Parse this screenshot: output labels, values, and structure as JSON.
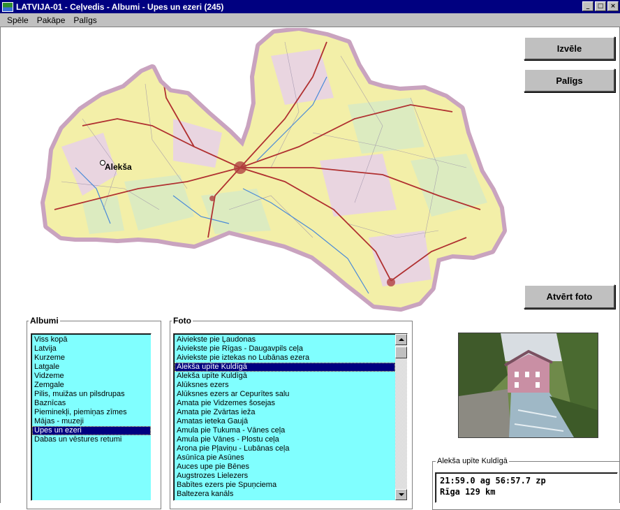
{
  "window": {
    "title": "LATVIJA-01 - Ceļvedis - Albumi - Upes un ezeri (245)",
    "controls": {
      "minimize": "_",
      "maximize": "□",
      "close": "×"
    }
  },
  "menu": [
    "Spēle",
    "Pakāpe",
    "Palīgs"
  ],
  "buttons": {
    "izvele": "Izvēle",
    "paligs": "Palīgs",
    "atvert_foto": "Atvērt foto"
  },
  "map": {
    "marker_label": "Alekša"
  },
  "albumi": {
    "label": "Albumi",
    "items": [
      "Viss kopā",
      "Latvija",
      "Kurzeme",
      "Latgale",
      "Vidzeme",
      "Zemgale",
      "Pilis, muižas un pilsdrupas",
      "Baznīcas",
      "Pieminekļi, piemiņas zīmes",
      "Mājas - muzeji",
      "Upes un ezeri",
      "Dabas un vēstures retumi"
    ],
    "selected_index": 10
  },
  "foto": {
    "label": "Foto",
    "items": [
      "Aiviekste pie Ļaudonas",
      "Aiviekste pie Rīgas - Daugavpils ceļa",
      "Aiviekste pie iztekas no Lubānas ezera",
      "Alekša upīte Kuldīgā",
      "Alekša upīte Kuldīgā",
      "Alūksnes ezers",
      "Alūksnes ezers ar Cepurītes salu",
      "Amata pie Vidzemes šosejas",
      "Amata pie Zvārtas ieža",
      "Amatas ieteka Gaujā",
      "Amula pie Tukuma - Vānes ceļa",
      "Amula pie Vānes - Plostu ceļa",
      "Arona pie Pļaviņu - Lubānas ceļa",
      "Asūnīca pie Asūnes",
      "Auces upe pie Bēnes",
      "Augstrozes Lielezers",
      "Babītes ezers pie Spuņciema",
      "Baltezera kanāls"
    ],
    "selected_index": 3
  },
  "info": {
    "caption": "Alekša upīte Kuldīgā",
    "line1": "21:59.0 ag  56:57.7 zp",
    "line2": "Rīga 129 km"
  },
  "colors": {
    "titlebar": "#000080",
    "list_bg": "#80ffff",
    "selection": "#000080",
    "map_border": "#c9a3bf",
    "map_land": "#f3efa8",
    "road": "#b03030"
  }
}
